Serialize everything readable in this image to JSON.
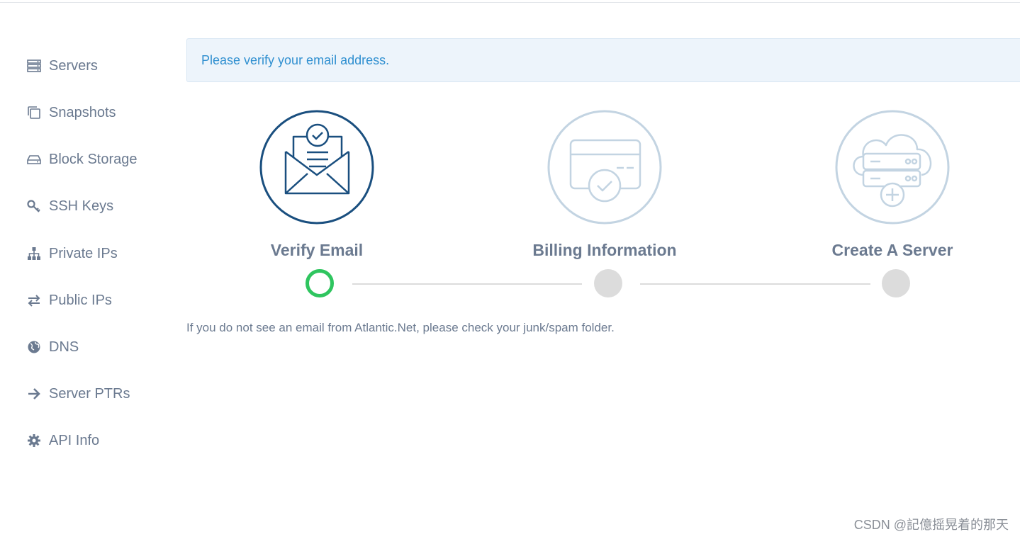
{
  "sidebar": {
    "items": [
      {
        "label": "Servers",
        "icon": "servers-icon"
      },
      {
        "label": "Snapshots",
        "icon": "snapshots-icon"
      },
      {
        "label": "Block Storage",
        "icon": "block-storage-icon"
      },
      {
        "label": "SSH Keys",
        "icon": "key-icon"
      },
      {
        "label": "Private IPs",
        "icon": "sitemap-icon"
      },
      {
        "label": "Public IPs",
        "icon": "exchange-icon"
      },
      {
        "label": "DNS",
        "icon": "globe-icon"
      },
      {
        "label": "Server PTRs",
        "icon": "arrow-right-icon"
      },
      {
        "label": "API Info",
        "icon": "gear-icon"
      }
    ]
  },
  "alert": {
    "text": "Please verify your email address."
  },
  "steps": [
    {
      "title": "Verify Email",
      "status": "active"
    },
    {
      "title": "Billing Information",
      "status": "inactive"
    },
    {
      "title": "Create A Server",
      "status": "inactive"
    }
  ],
  "note": "If you do not see an email from Atlantic.Net, please check your junk/spam folder.",
  "watermark": "CSDN @記億摇晃着的那天",
  "colors": {
    "text": "#6b7a90",
    "alert_text": "#2f8fd0",
    "alert_bg": "#edf4fb",
    "active_step": "#1a4f7f",
    "inactive_step": "#c3d4e2",
    "active_dot": "#2fc55f",
    "inactive_dot": "#dcdcdc"
  }
}
